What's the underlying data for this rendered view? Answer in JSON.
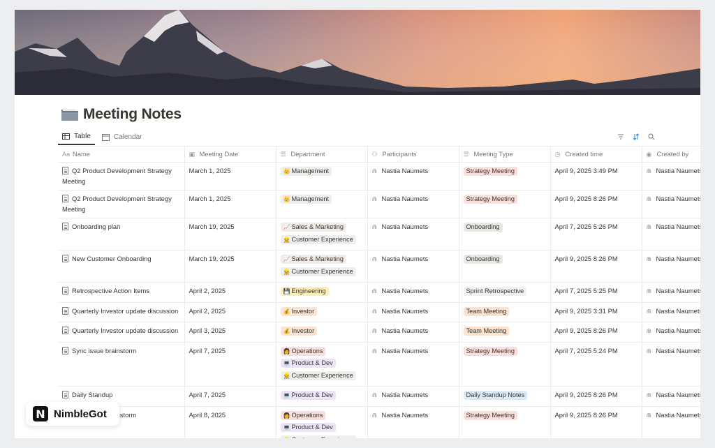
{
  "page": {
    "title": "Meeting Notes",
    "title_icon": "folder-icon"
  },
  "views": [
    {
      "label": "Table",
      "icon": "table-icon",
      "active": true
    },
    {
      "label": "Calendar",
      "icon": "calendar-icon",
      "active": false
    }
  ],
  "toolbar": {
    "icons": [
      "filter-icon",
      "sort-icon",
      "search-icon"
    ]
  },
  "columns": [
    "Name",
    "Meeting Date",
    "Department",
    "Participants",
    "Meeting Type",
    "Created time",
    "Created by"
  ],
  "tag_colors": {
    "Management": "#eeeeed",
    "Sales & Marketing": "#f1ece7",
    "Customer Experience": "#eeeeed",
    "Engineering": "#fbeeb8",
    "Investor": "#fae4d3",
    "Operations": "#f7dfdc",
    "Product & Dev": "#ece4f6",
    "Strategy Meeting": "#fadfdb",
    "Onboarding": "#e8e7e4",
    "Sprint Retrospective": "#f1f1ef",
    "Team Meeting": "#fbe2cf",
    "Daily Standup Notes": "#dbeaf6"
  },
  "rows": [
    {
      "name": "Q2 Product Development Strategy Meeting",
      "date": "March 1, 2025",
      "departments": [
        {
          "emoji": "👑",
          "label": "Management"
        }
      ],
      "participant": "Nastia Naumets",
      "type": "Strategy Meeting",
      "created": "April 9, 2025 3:49 PM",
      "created_by": "Nastia Naumets"
    },
    {
      "name": "Q2 Product Development Strategy Meeting",
      "date": "March 1, 2025",
      "departments": [
        {
          "emoji": "👑",
          "label": "Management"
        }
      ],
      "participant": "Nastia Naumets",
      "type": "Strategy Meeting",
      "created": "April 9, 2025 8:26 PM",
      "created_by": "Nastia Naumets"
    },
    {
      "name": "Onboarding plan",
      "date": "March 19, 2025",
      "departments": [
        {
          "emoji": "📈",
          "label": "Sales & Marketing"
        },
        {
          "emoji": "👷",
          "label": "Customer Experience"
        }
      ],
      "participant": "Nastia Naumets",
      "type": "Onboarding",
      "created": "April 7, 2025 5:26 PM",
      "created_by": "Nastia Naumets"
    },
    {
      "name": "New Customer Onboarding",
      "date": "March 19, 2025",
      "departments": [
        {
          "emoji": "📈",
          "label": "Sales & Marketing"
        },
        {
          "emoji": "👷",
          "label": "Customer Experience"
        }
      ],
      "participant": "Nastia Naumets",
      "type": "Onboarding",
      "created": "April 9, 2025 8:26 PM",
      "created_by": "Nastia Naumets"
    },
    {
      "name": "Retrospective Action Items",
      "date": "April 2, 2025",
      "departments": [
        {
          "emoji": "💾",
          "label": "Engineering"
        }
      ],
      "participant": "Nastia Naumets",
      "type": "Sprint Retrospective",
      "created": "April 7, 2025 5:25 PM",
      "created_by": "Nastia Naumets"
    },
    {
      "name": "Quarterly Investor update discussion",
      "date": "April 2, 2025",
      "departments": [
        {
          "emoji": "💰",
          "label": "Investor"
        }
      ],
      "participant": "Nastia Naumets",
      "type": "Team Meeting",
      "created": "April 9, 2025 3:31 PM",
      "created_by": "Nastia Naumets"
    },
    {
      "name": "Quarterly Investor update discussion",
      "date": "April 3, 2025",
      "departments": [
        {
          "emoji": "💰",
          "label": "Investor"
        }
      ],
      "participant": "Nastia Naumets",
      "type": "Team Meeting",
      "created": "April 9, 2025 8:26 PM",
      "created_by": "Nastia Naumets"
    },
    {
      "name": "Sync issue brainstorm",
      "date": "April 7, 2025",
      "departments": [
        {
          "emoji": "👩",
          "label": "Operations"
        },
        {
          "emoji": "💻",
          "label": "Product & Dev"
        },
        {
          "emoji": "👷",
          "label": "Customer Experience"
        }
      ],
      "participant": "Nastia Naumets",
      "type": "Strategy Meeting",
      "created": "April 7, 2025 5:24 PM",
      "created_by": "Nastia Naumets"
    },
    {
      "name": "Daily Standup",
      "date": "April 7, 2025",
      "departments": [
        {
          "emoji": "💻",
          "label": "Product & Dev"
        }
      ],
      "participant": "Nastia Naumets",
      "type": "Daily Standup Notes",
      "created": "April 9, 2025 8:26 PM",
      "created_by": "Nastia Naumets"
    },
    {
      "name": "Sync issue brainstorm",
      "date": "April 8, 2025",
      "departments": [
        {
          "emoji": "👩",
          "label": "Operations"
        },
        {
          "emoji": "💻",
          "label": "Product & Dev"
        },
        {
          "emoji": "👷",
          "label": "Customer Experience"
        }
      ],
      "participant": "Nastia Naumets",
      "type": "Strategy Meeting",
      "created": "April 9, 2025 8:26 PM",
      "created_by": "Nastia Naumets"
    }
  ],
  "branding": {
    "logo_letter": "N",
    "logo_text": "NimbleGot"
  }
}
